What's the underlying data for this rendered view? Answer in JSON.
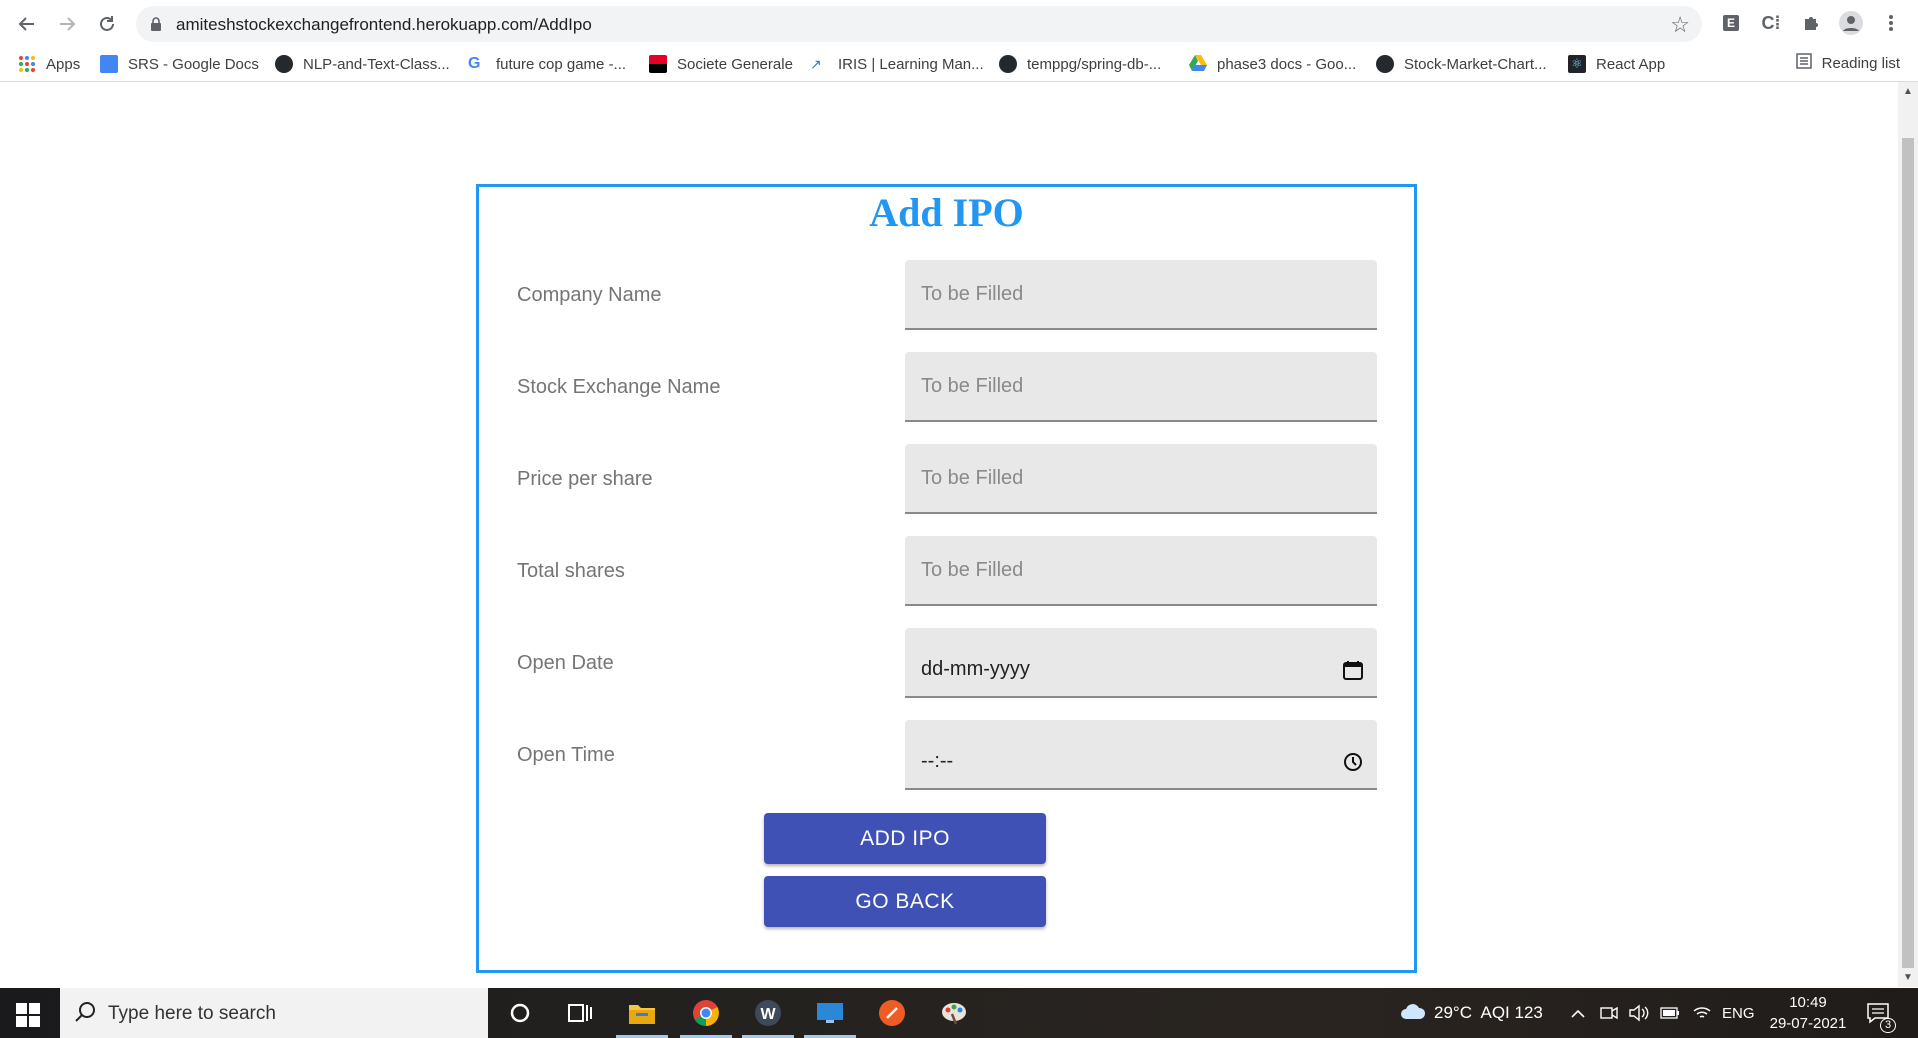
{
  "browser": {
    "url": "amiteshstockexchangefrontend.herokuapp.com/AddIpo",
    "extensions": [
      "E",
      "C⁞"
    ],
    "bookmarks": [
      {
        "label": "Apps",
        "icon": "apps-grid-icon"
      },
      {
        "label": "SRS - Google Docs",
        "icon": "google-docs-icon"
      },
      {
        "label": "NLP-and-Text-Class...",
        "icon": "github-icon"
      },
      {
        "label": "future cop game -...",
        "icon": "google-icon"
      },
      {
        "label": "Societe Generale",
        "icon": "societe-generale-icon"
      },
      {
        "label": "IRIS | Learning Man...",
        "icon": "iris-icon"
      },
      {
        "label": "temppg/spring-db-...",
        "icon": "github-icon"
      },
      {
        "label": "phase3 docs - Goo...",
        "icon": "google-drive-icon"
      },
      {
        "label": "Stock-Market-Chart...",
        "icon": "github-icon"
      },
      {
        "label": "React App",
        "icon": "react-icon"
      }
    ],
    "reading_list": "Reading list"
  },
  "form": {
    "title": "Add IPO",
    "fields": [
      {
        "label": "Company Name",
        "placeholder": "To be Filled"
      },
      {
        "label": "Stock Exchange Name",
        "placeholder": "To be Filled"
      },
      {
        "label": "Price per share",
        "placeholder": "To be Filled"
      },
      {
        "label": "Total shares",
        "placeholder": "To be Filled"
      },
      {
        "label": "Open Date",
        "value": "dd-mm-yyyy"
      },
      {
        "label": "Open Time",
        "value": "--:--"
      }
    ],
    "add_button": "ADD IPO",
    "back_button": "GO BACK"
  },
  "taskbar": {
    "search_placeholder": "Type here to search",
    "weather": "29°C  AQI 123",
    "language": "ENG",
    "time": "10:49",
    "date": "29-07-2021",
    "notifications": "3"
  }
}
